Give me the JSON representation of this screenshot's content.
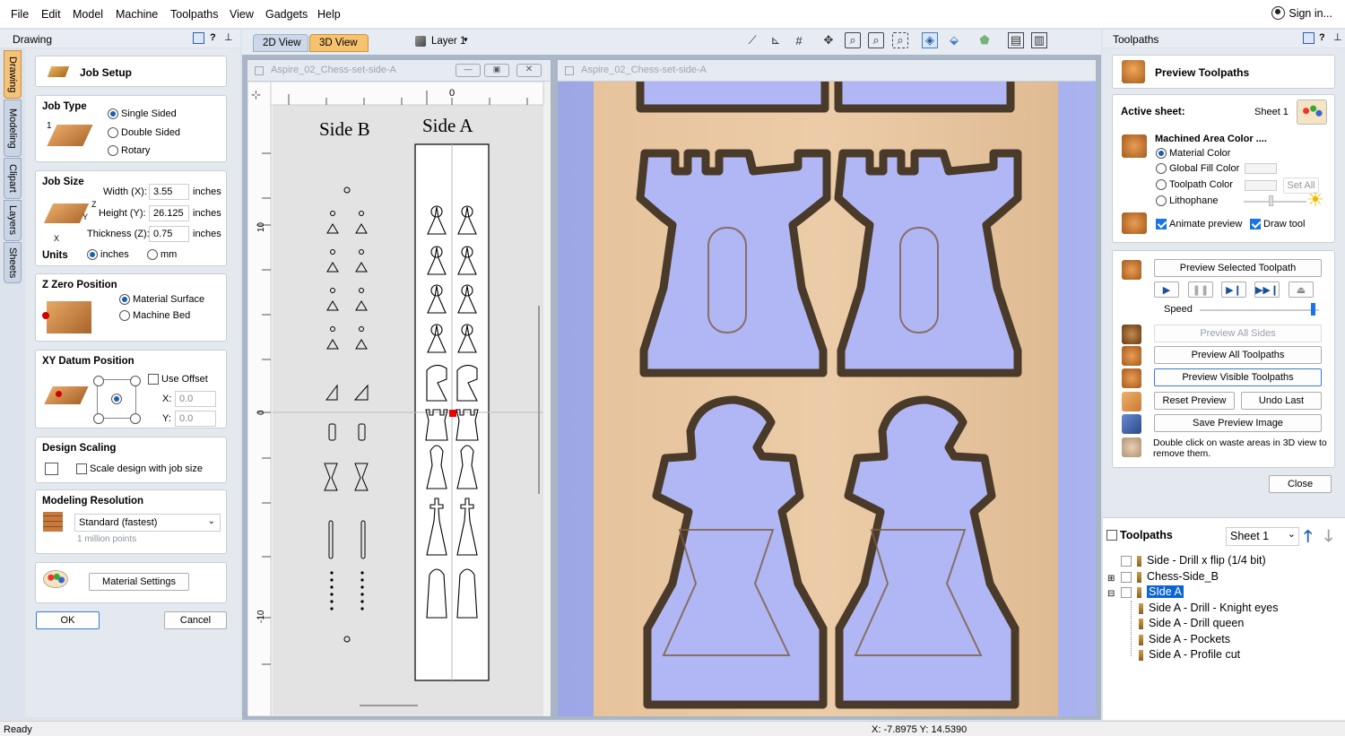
{
  "menubar": {
    "items": [
      "File",
      "Edit",
      "Model",
      "Machine",
      "Toolpaths",
      "View",
      "Gadgets",
      "Help"
    ],
    "signin": "Sign in..."
  },
  "left_panel": {
    "title": "Drawing",
    "help": "?",
    "vertical_tabs": [
      "Drawing",
      "Modeling",
      "Clipart",
      "Layers",
      "Sheets"
    ]
  },
  "job_setup": {
    "title": "Job Setup",
    "job_type": {
      "heading": "Job Type",
      "options": [
        "Single Sided",
        "Double Sided",
        "Rotary"
      ],
      "selected": "Single Sided",
      "icon_label": "1"
    },
    "job_size": {
      "heading": "Job Size",
      "width_label": "Width (X):",
      "width": "3.55",
      "height_label": "Height (Y):",
      "height": "26.125",
      "thickness_label": "Thickness (Z):",
      "thickness": "0.75",
      "unit": "inches",
      "units_heading": "Units",
      "unit_options": [
        "inches",
        "mm"
      ],
      "selected_unit": "inches",
      "axis_x": "X",
      "axis_y": "Y",
      "axis_z": "Z"
    },
    "z_zero": {
      "heading": "Z Zero Position",
      "options": [
        "Material Surface",
        "Machine Bed"
      ],
      "selected": "Material Surface"
    },
    "xy_datum": {
      "heading": "XY Datum Position",
      "use_offset": "Use Offset",
      "x_label": "X:",
      "x": "0.0",
      "y_label": "Y:",
      "y": "0.0"
    },
    "design_scaling": {
      "heading": "Design Scaling",
      "checkbox": "Scale design with job size"
    },
    "modeling_resolution": {
      "heading": "Modeling Resolution",
      "selected": "Standard (fastest)",
      "note": "1 million points"
    },
    "material_settings": "Material Settings",
    "ok": "OK",
    "cancel": "Cancel"
  },
  "views": {
    "tab_2d": "2D View",
    "tab_3d": "3D View",
    "layer": "Layer 1"
  },
  "window_2d": {
    "title": "Aspire_02_Chess-set-side-A",
    "label_side_b": "Side B",
    "label_side_a": "Side A",
    "ruler_top_zero": "0",
    "ruler_left": [
      "10",
      "0",
      "-10"
    ]
  },
  "window_3d": {
    "title": "Aspire_02_Chess-set-side-A"
  },
  "right_panel": {
    "title": "Toolpaths",
    "help": "?",
    "preview_title": "Preview Toolpaths",
    "active_sheet_label": "Active sheet:",
    "active_sheet": "Sheet 1",
    "machined_area": "Machined Area Color ....",
    "color_options": [
      "Material Color",
      "Global Fill Color",
      "Toolpath Color",
      "Lithophane"
    ],
    "selected_color": "Material Color",
    "set_all": "Set All",
    "animate_preview": "Animate preview",
    "draw_tool": "Draw tool",
    "preview_selected": "Preview Selected Toolpath",
    "speed_label": "Speed",
    "speed": 0.97,
    "preview_all_sides": "Preview All Sides",
    "preview_all": "Preview All Toolpaths",
    "preview_visible": "Preview Visible Toolpaths",
    "reset_preview": "Reset Preview",
    "undo_last": "Undo Last",
    "save_preview_image": "Save Preview Image",
    "hint": "Double click on waste areas in 3D view to remove them.",
    "close": "Close"
  },
  "toolpaths_list": {
    "heading": "Toolpaths",
    "sheet": "Sheet 1",
    "items": [
      {
        "label": "Side - Drill x flip (1/4 bit)",
        "level": 0
      },
      {
        "label": "Chess-Side_B",
        "level": 0
      },
      {
        "label": "SIde A",
        "level": 0,
        "selected": true
      },
      {
        "label": "Side A - Drill - Knight eyes",
        "level": 1
      },
      {
        "label": "Side A - Drill queen",
        "level": 1
      },
      {
        "label": "Side A - Pockets",
        "level": 1
      },
      {
        "label": "Side A - Profile cut",
        "level": 1
      }
    ]
  },
  "status": {
    "ready": "Ready",
    "coords": "X: -7.8975 Y: 14.5390"
  }
}
